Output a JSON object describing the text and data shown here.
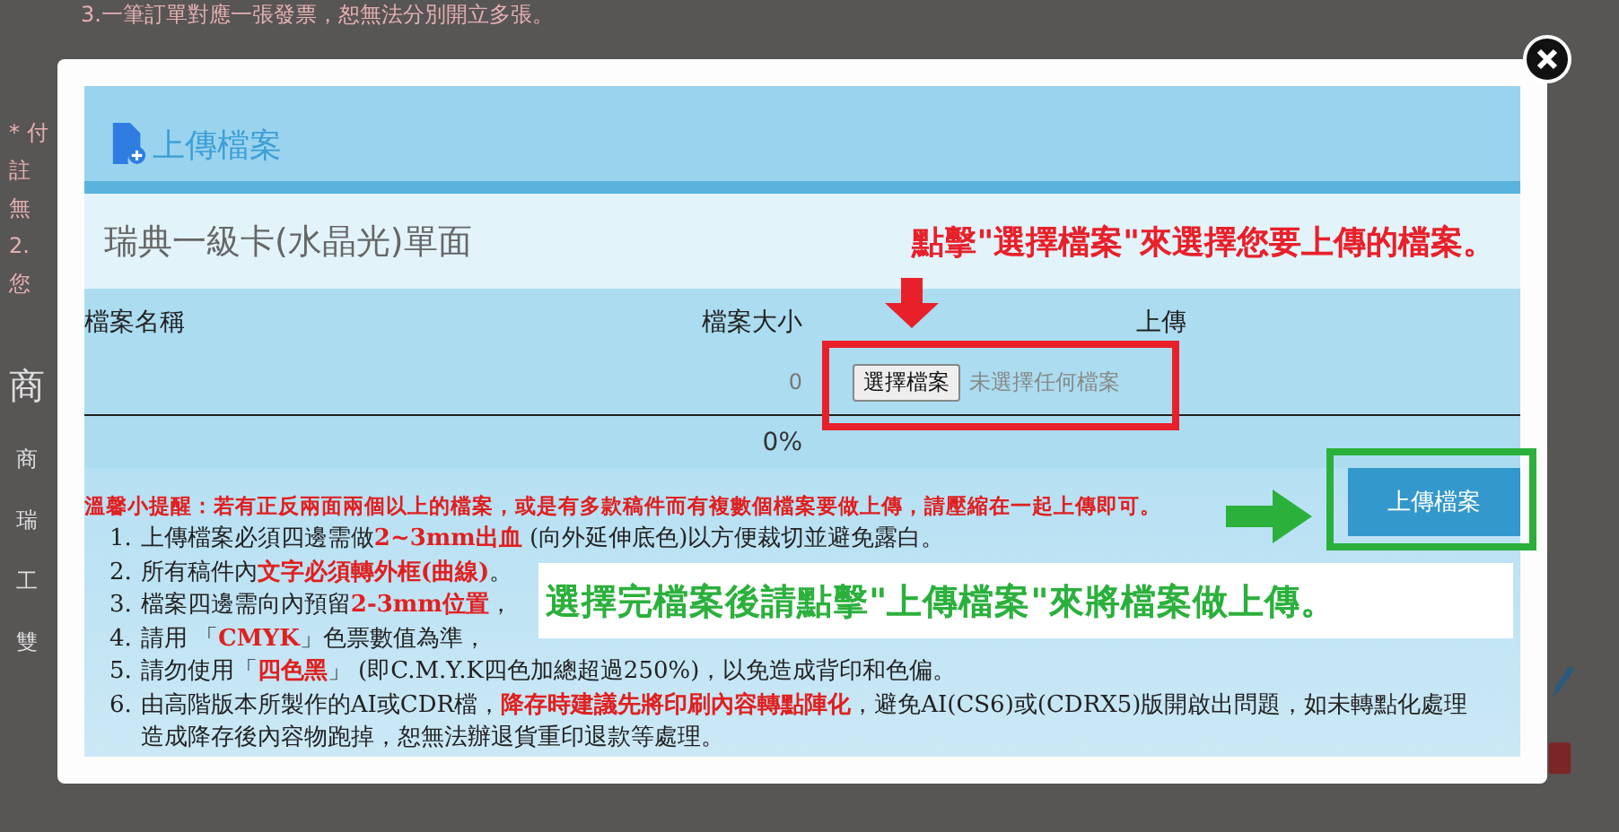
{
  "background_page": {
    "top_note": "3.一筆訂單對應一張發票，恕無法分別開立多張。",
    "side_fragments": [
      "* 付",
      "註",
      "無",
      "2.",
      "您"
    ],
    "section_heading": "商",
    "card_fragments": [
      "商",
      "瑞",
      "工",
      "雙"
    ]
  },
  "dialog": {
    "title": "上傳檔案",
    "product_name": "瑞典一級卡(水晶光)單面",
    "table": {
      "columns": [
        "檔案名稱",
        "檔案大小",
        "上傳"
      ],
      "rows": [
        {
          "file_size": "0",
          "choose_button": "選擇檔案",
          "file_status": "未選擇任何檔案"
        }
      ],
      "progress": "0%"
    },
    "upload_button": "上傳檔案",
    "notes_intro": "溫馨小提醒：若有正反兩面兩個以上的檔案，或是有多款稿件而有複數個檔案要做上傳，請壓縮在一起上傳即可。",
    "notes": [
      {
        "number": "1.",
        "parts": [
          {
            "text": "上傳檔案必須四邊需做",
            "emphasis": false
          },
          {
            "text": "2~3mm出血",
            "emphasis": true
          },
          {
            "text": " (向外延伸底色)以方便裁切並避免露白。",
            "emphasis": false
          }
        ]
      },
      {
        "number": "2.",
        "parts": [
          {
            "text": "所有稿件內",
            "emphasis": false
          },
          {
            "text": "文字必須轉外框(曲線)",
            "emphasis": true
          },
          {
            "text": "。",
            "emphasis": false
          }
        ]
      },
      {
        "number": "3.",
        "parts": [
          {
            "text": "檔案四邊需向內預留",
            "emphasis": false
          },
          {
            "text": "2-3mm位置",
            "emphasis": true
          },
          {
            "text": "，",
            "emphasis": false
          }
        ]
      },
      {
        "number": "4.",
        "parts": [
          {
            "text": "請用 「",
            "emphasis": false
          },
          {
            "text": "CMYK",
            "emphasis": true
          },
          {
            "text": "」色票數值為準，",
            "emphasis": false
          }
        ]
      },
      {
        "number": "5.",
        "parts": [
          {
            "text": "請勿使用「",
            "emphasis": false
          },
          {
            "text": "四色黑",
            "emphasis": true
          },
          {
            "text": "」 (即C.M.Y.K四色加總超過250%)，以免造成背印和色偏。",
            "emphasis": false
          }
        ]
      },
      {
        "number": "6.",
        "parts": [
          {
            "text": "由高階版本所製作的AI或CDR檔，",
            "emphasis": false
          },
          {
            "text": "降存時建議先將印刷內容轉點陣化",
            "emphasis": true
          },
          {
            "text": "，避免AI(CS6)或(CDRX5)版開啟出問題，如未轉點化處理造成降存後內容物跑掉，恕無法辦退貨重印退款等處理。",
            "emphasis": false
          }
        ]
      }
    ]
  },
  "annotations": {
    "choose_hint": "點擊\"選擇檔案\"來選擇您要上傳的檔案。",
    "upload_hint": "選擇完檔案後請點擊\"上傳檔案\"來將檔案做上傳。"
  }
}
